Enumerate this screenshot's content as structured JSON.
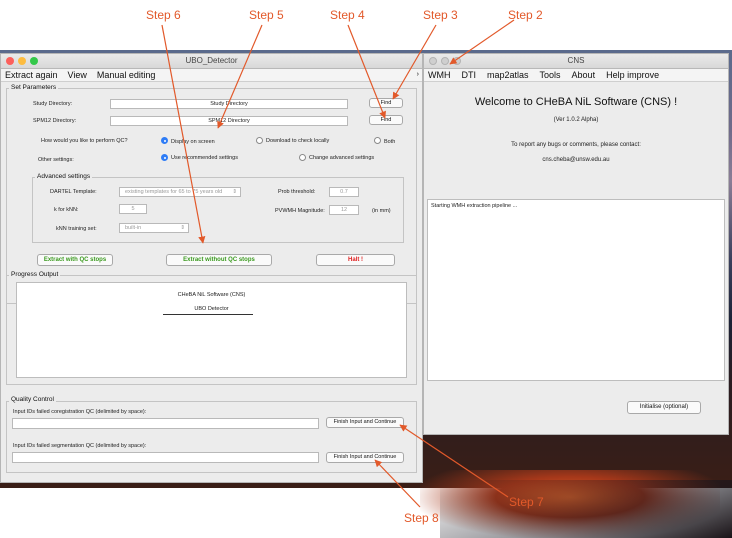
{
  "steps": [
    "Step 6",
    "Step 5",
    "Step 4",
    "Step 3",
    "Step 2",
    "Step 7",
    "Step 8"
  ],
  "ubo": {
    "title": "UBO_Detector",
    "menu": [
      "Extract again",
      "View",
      "Manual editing"
    ],
    "set_parameters": "Set Parameters",
    "study_dir_label": "Study Directory:",
    "study_dir_value": "Study Directory",
    "spm12_dir_label": "SPM12 Directory:",
    "spm12_dir_value": "SPM12 Directory",
    "find": "Find",
    "qc_question": "How would you like to perform QC?",
    "qc_options": [
      "Display on screen",
      "Download to check locally",
      "Both"
    ],
    "other_settings_label": "Other settings:",
    "other_options": [
      "Use recommended settings",
      "Change advanced settings"
    ],
    "advanced_title": "Advanced settings",
    "dartel_label": "DARTEL Template:",
    "dartel_value": "existing templates for 65 to 75 years old",
    "prob_label": "Prob threshold:",
    "prob_value": "0.7",
    "knn_label": "k for kNN:",
    "knn_value": "5",
    "pvwmh_label": "PVWMH Magnitude:",
    "pvwmh_value": "12",
    "pvwmh_unit": "(in mm)",
    "knn_set_label": "kNN training set:",
    "knn_set_value": "built-in",
    "btn_extract_qc": "Extract with QC stops",
    "btn_extract_noqc": "Extract without QC stops",
    "btn_halt": "Halt !",
    "progress_title": "Progress Output",
    "progress_line1": "CHeBA NiL Software (CNS)",
    "progress_line2": "UBO Detector",
    "qc_title": "Quality Control",
    "coreg_label": "Input IDs failed coregistration QC (delimited by space):",
    "seg_label": "Input IDs failed segmentation QC (delimited by space):",
    "finish_btn": "Finish Input and Continue"
  },
  "cns": {
    "title": "CNS",
    "menu": [
      "WMH",
      "DTI",
      "map2atlas",
      "Tools",
      "About",
      "Help improve"
    ],
    "welcome": "Welcome to CHeBA NiL Software (CNS) !",
    "version": "(Ver 1.0.2 Alpha)",
    "report": "To report any bugs or comments, please contact:",
    "email": "cns.cheba@unsw.edu.au",
    "log": "Starting WMH extraction pipeline ...",
    "initialise": "Initialise (optional)"
  },
  "colors": {
    "accent": "#e2592a",
    "green": "#3a9a1e",
    "red": "#e02020",
    "radio": "#2e7cf6"
  }
}
